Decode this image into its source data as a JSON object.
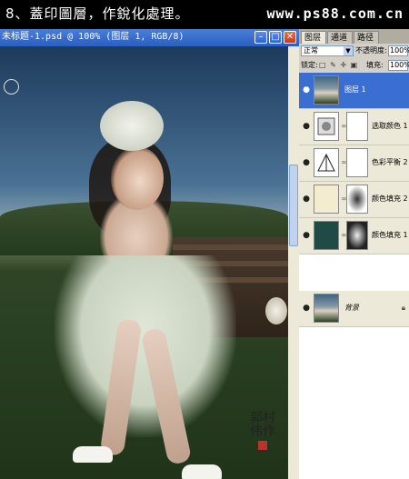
{
  "banner": {
    "title": "8、蓋印圖層，作銳化處理。",
    "site": "www.ps88.com.cn"
  },
  "document": {
    "title": "未标题-1.psd @ 100% (图层 1, RGB/8)",
    "min_glyph": "–",
    "max_glyph": "□",
    "close_glyph": "✕"
  },
  "panel": {
    "tabs": [
      "图层",
      "通道",
      "路径"
    ],
    "blend_mode": "正常",
    "opacity_label": "不透明度:",
    "opacity_value": "100%",
    "lock_label": "锁定:",
    "lock_icons": "□ ✎ ✛ ▣",
    "fill_label": "填充:",
    "fill_value": "100%",
    "layers": [
      {
        "name": "图层 1",
        "thumb": "photo",
        "selected": true
      },
      {
        "name": "选取颜色 1",
        "thumb": "selective-color",
        "selected": false
      },
      {
        "name": "色彩平衡 2",
        "thumb": "color-balance",
        "selected": false
      },
      {
        "name": "颜色填充 2",
        "thumb": "fill-cream",
        "thumb_color": "#f4ecd0",
        "selected": false
      },
      {
        "name": "颜色填充 1",
        "thumb": "fill-teal",
        "thumb_color": "#1f4a46",
        "selected": false
      },
      {
        "name": "背景",
        "thumb": "photo",
        "selected": false,
        "locked": true
      }
    ]
  },
  "signature": {
    "text": "郭村伟作"
  },
  "colors": {
    "selected_layer": "#3a6ed0",
    "titlebar": "#2a5ec0"
  }
}
